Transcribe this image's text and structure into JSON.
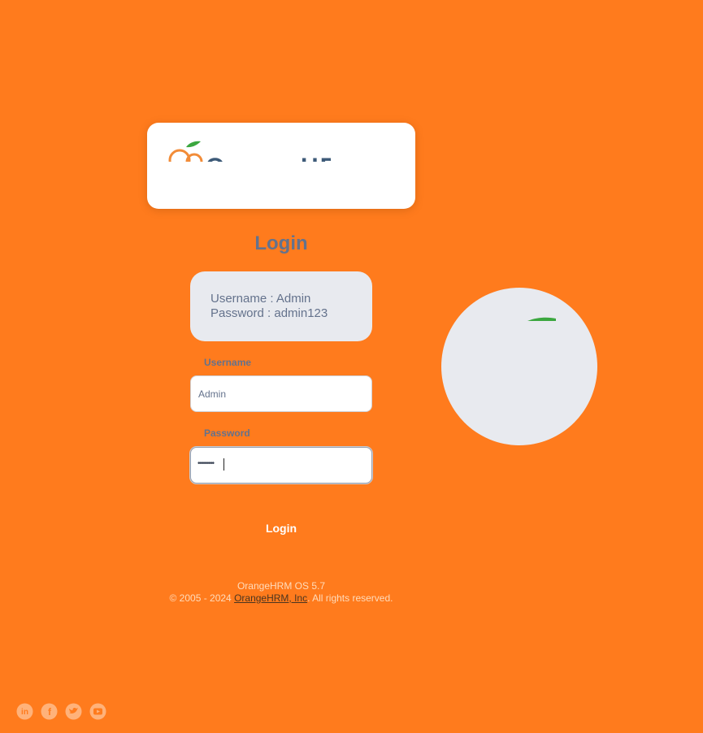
{
  "brand": {
    "logo_text": "OrangeHRM",
    "brand_green": "#3ba73f",
    "brand_orange": "#f28c38"
  },
  "login": {
    "title": "Login",
    "credentials": {
      "username_line": "Username : Admin",
      "password_line": "Password : admin123"
    },
    "username_label": "Username",
    "username_value": "Admin",
    "password_label": "Password",
    "password_masked": "••••••••",
    "submit_label": "Login"
  },
  "footer": {
    "version": "OrangeHRM OS 5.7",
    "copyright_prefix": "© 2005 - 2024 ",
    "company_link": "OrangeHRM, Inc",
    "rights": ". All rights reserved."
  },
  "social": [
    "linkedin-icon",
    "facebook-icon",
    "twitter-icon",
    "youtube-icon"
  ],
  "colors": {
    "background": "#ff7b1d",
    "card": "#ffffff",
    "panel": "#e8eaef",
    "text": "#64728c"
  }
}
